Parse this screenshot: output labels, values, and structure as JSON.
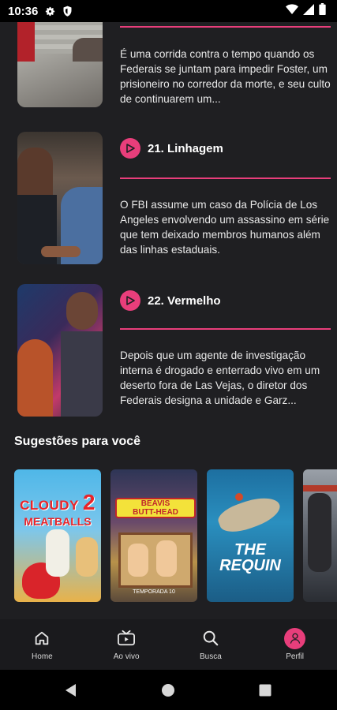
{
  "status_bar": {
    "time": "10:36",
    "icons": [
      "settings-gear-icon",
      "shield-icon",
      "wifi-icon",
      "signal-icon",
      "battery-icon"
    ]
  },
  "episodes": [
    {
      "number_title": "",
      "description": "É uma corrida contra o tempo quando os Federais se juntam para impedir Foster, um prisioneiro no corredor da morte, e seu culto de continuarem um..."
    },
    {
      "number_title": "21. Linhagem",
      "description": "O FBI assume um caso da Polícia de Los Angeles envolvendo um assassino em série que tem deixado membros humanos além das linhas estaduais."
    },
    {
      "number_title": "22. Vermelho",
      "description": "Depois que um agente de investigação interna é drogado e enterrado vivo em um deserto fora de Las Vejas, o diretor dos Federais designa a unidade e Garz..."
    }
  ],
  "suggestions": {
    "title": "Sugestões para você",
    "posters": [
      {
        "name": "Cloudy 2 poster",
        "line1": "CLOUDY",
        "line2": "MEATBALLS",
        "badge": "2"
      },
      {
        "name": "Beavis and Butt-Head poster",
        "line1": "BEAVIS",
        "line2": "BUTT-HEAD",
        "badge": "TEMPORADA 10"
      },
      {
        "name": "The Requin poster",
        "line1": "THE",
        "line2": "REQUIN",
        "badge": ""
      },
      {
        "name": "Action movie poster",
        "line1": "",
        "line2": "",
        "badge": ""
      }
    ]
  },
  "bottom_nav": [
    {
      "label": "Home",
      "icon": "home-icon"
    },
    {
      "label": "Ao vivo",
      "icon": "live-tv-icon"
    },
    {
      "label": "Busca",
      "icon": "search-icon"
    },
    {
      "label": "Perfil",
      "icon": "profile-icon"
    }
  ],
  "colors": {
    "accent": "#e83e7b",
    "background": "#1f1f22"
  }
}
